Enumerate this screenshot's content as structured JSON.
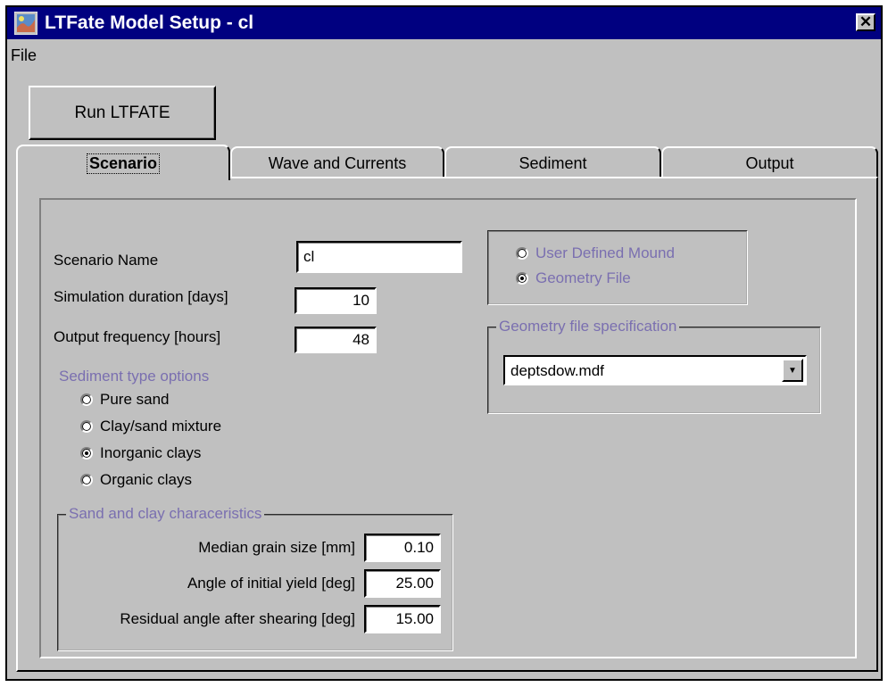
{
  "window": {
    "title": "LTFate Model Setup - cl",
    "close_label": "✕"
  },
  "menu": {
    "file": "File"
  },
  "toolbar": {
    "run_label": "Run LTFATE"
  },
  "tabs": [
    {
      "label": "Scenario",
      "active": true
    },
    {
      "label": "Wave and Currents",
      "active": false
    },
    {
      "label": "Sediment",
      "active": false
    },
    {
      "label": "Output",
      "active": false
    }
  ],
  "scenario": {
    "name_label": "Scenario Name",
    "name_value": "cl",
    "duration_label": "Simulation duration [days]",
    "duration_value": "10",
    "frequency_label": "Output frequency [hours]",
    "frequency_value": "48"
  },
  "sediment_options": {
    "title": "Sediment type options",
    "options": [
      {
        "label": "Pure sand",
        "selected": false
      },
      {
        "label": "Clay/sand mixture",
        "selected": false
      },
      {
        "label": "Inorganic clays",
        "selected": true
      },
      {
        "label": "Organic clays",
        "selected": false
      }
    ]
  },
  "characteristics": {
    "title": "Sand and clay characeristics",
    "grain_label": "Median grain size [mm]",
    "grain_value": "0.10",
    "yield_label": "Angle of initial yield [deg]",
    "yield_value": "25.00",
    "residual_label": "Residual angle after shearing [deg]",
    "residual_value": "15.00"
  },
  "mound_type": {
    "options": [
      {
        "label": "User Defined Mound",
        "selected": false
      },
      {
        "label": "Geometry File",
        "selected": true
      }
    ]
  },
  "geometry": {
    "title": "Geometry file specification",
    "file_value": "deptsdow.mdf",
    "dropdown_icon": "chevron-down-icon"
  },
  "colors": {
    "titlebar": "#000080",
    "face": "#c0c0c0",
    "disabled_text": "#7a6fb0"
  }
}
